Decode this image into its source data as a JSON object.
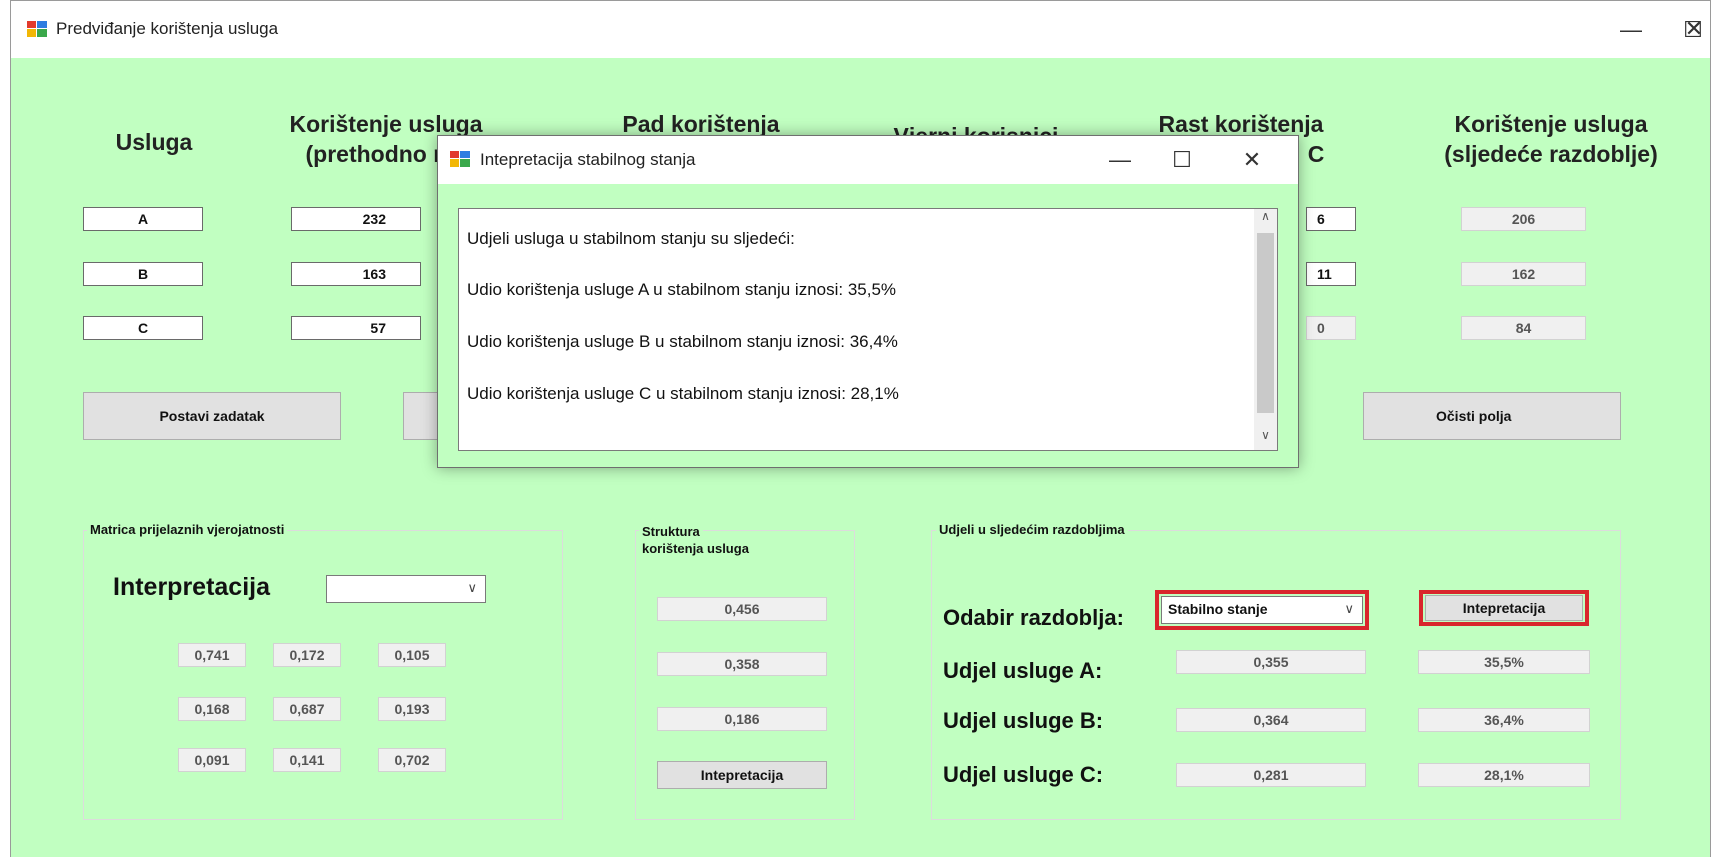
{
  "window": {
    "title": "Predviđanje korištenja usluga",
    "minimize": "—",
    "maximize": "☐",
    "close": "✕"
  },
  "headers": {
    "usluga": "Usluga",
    "prethodno_l1": "Korištenje usluga",
    "prethodno_l2": "(prethodno raz",
    "pad_l1": "Pad korištenja",
    "vjerni": "Vjerni korisnici",
    "rast_l1": "Rast korištenja",
    "rast_l2": "C",
    "sljedece_l1": "Korištenje usluga",
    "sljedece_l2": "(sljedeće razdoblje)"
  },
  "rows": [
    {
      "usluga": "A",
      "prethodno": "232",
      "rast": "6",
      "sljedece": "206"
    },
    {
      "usluga": "B",
      "prethodno": "163",
      "rast": "11",
      "sljedece": "162"
    },
    {
      "usluga": "C",
      "prethodno": "57",
      "rast": "0",
      "sljedece": "84"
    }
  ],
  "buttons": {
    "postavi": "Postavi zadatak",
    "ocisti": "Očisti polja",
    "interpretacija1": "Intepretacija",
    "interpretacija2": "Intepretacija"
  },
  "matrix_group": {
    "title": "Matrica prijelaznih vjerojatnosti",
    "label": "Interpretacija",
    "combo_value": "",
    "values": [
      [
        "0,741",
        "0,172",
        "0,105"
      ],
      [
        "0,168",
        "0,687",
        "0,193"
      ],
      [
        "0,091",
        "0,141",
        "0,702"
      ]
    ]
  },
  "struktura_group": {
    "title_l1": "Struktura",
    "title_l2": "korištenja usluga",
    "values": [
      "0,456",
      "0,358",
      "0,186"
    ]
  },
  "udjeli_group": {
    "title": "Udjeli u sljedećim razdobljima",
    "odabir_label": "Odabir razdoblja:",
    "odabir_value": "Stabilno stanje",
    "rows": [
      {
        "label": "Udjel usluge A:",
        "value": "0,355",
        "percent": "35,5%"
      },
      {
        "label": "Udjel usluge B:",
        "value": "0,364",
        "percent": "36,4%"
      },
      {
        "label": "Udjel usluge C:",
        "value": "0,281",
        "percent": "28,1%"
      }
    ]
  },
  "dialog": {
    "title": "Intepretacija stabilnog stanja",
    "lines": [
      "Udjeli usluga u stabilnom stanju su sljedeći:",
      "Udio korištenja usluge A u stabilnom stanju iznosi: 35,5%",
      "Udio korištenja usluge B u stabilnom stanju iznosi: 36,4%",
      "Udio korištenja usluge C u stabilnom stanju iznosi: 28,1%"
    ]
  },
  "colors": {
    "background": "#c1ffc1",
    "highlight": "#d9262c"
  }
}
